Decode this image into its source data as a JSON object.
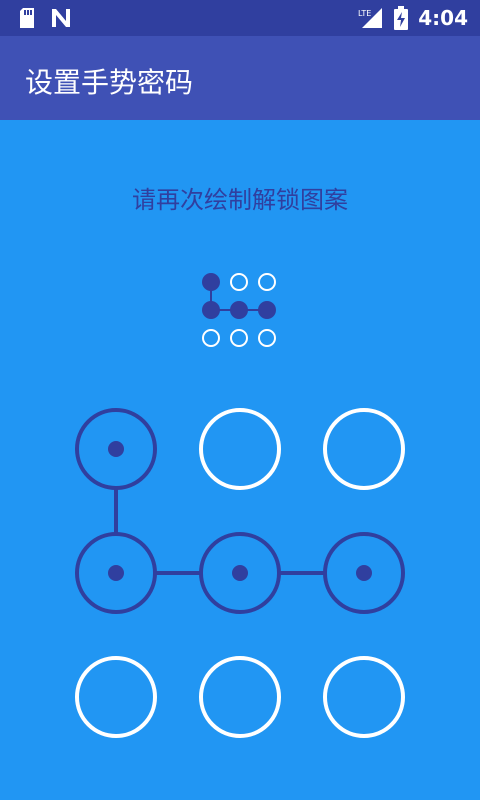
{
  "status_bar": {
    "time": "4:04",
    "network_label": "LTE",
    "icons": [
      "sd-card-icon",
      "n-notification-icon",
      "lte-signal-icon",
      "battery-charging-icon"
    ]
  },
  "app_bar": {
    "title": "设置手势密码"
  },
  "prompt": {
    "text": "请再次绘制解锁图案"
  },
  "pattern": {
    "selected": [
      0,
      3,
      4,
      5
    ],
    "path": [
      0,
      3,
      4,
      5
    ],
    "colors": {
      "active": "#303f9f",
      "inactive_ring": "#ffffff",
      "background": "#2196f3"
    }
  }
}
